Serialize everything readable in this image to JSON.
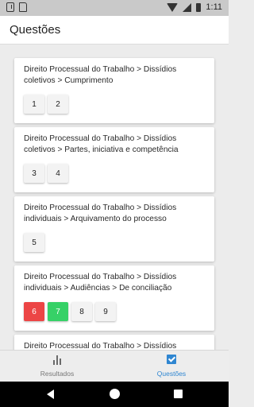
{
  "status_bar": {
    "time": "1:11",
    "icons": [
      "download-icon",
      "sd-card-icon",
      "wifi-icon",
      "signal-icon",
      "battery-icon"
    ]
  },
  "app_bar": {
    "title": "Questões"
  },
  "cards": [
    {
      "title": "Direito Processual do Trabalho > Dissídios coletivos > Cumprimento",
      "questions": [
        {
          "label": "1",
          "status": "neutral"
        },
        {
          "label": "2",
          "status": "neutral"
        }
      ]
    },
    {
      "title": "Direito Processual do Trabalho > Dissídios coletivos > Partes, iniciativa e competência",
      "questions": [
        {
          "label": "3",
          "status": "neutral"
        },
        {
          "label": "4",
          "status": "neutral"
        }
      ]
    },
    {
      "title": "Direito Processual do Trabalho > Dissídios individuais > Arquivamento do processo",
      "questions": [
        {
          "label": "5",
          "status": "neutral"
        }
      ]
    },
    {
      "title": "Direito Processual do Trabalho > Dissídios individuais > Audiências > De conciliação",
      "questions": [
        {
          "label": "6",
          "status": "wrong"
        },
        {
          "label": "7",
          "status": "correct"
        },
        {
          "label": "8",
          "status": "neutral"
        },
        {
          "label": "9",
          "status": "neutral"
        }
      ]
    },
    {
      "title": "Direito Processual do Trabalho > Dissídios",
      "questions": []
    }
  ],
  "bottom_nav": {
    "items": [
      {
        "label": "Resultados",
        "icon": "bar-chart-icon",
        "active": false
      },
      {
        "label": "Questões",
        "icon": "checkbox-icon",
        "active": true
      }
    ]
  },
  "colors": {
    "active": "#2f86d1",
    "wrong": "#ec4545",
    "correct": "#36d167"
  }
}
